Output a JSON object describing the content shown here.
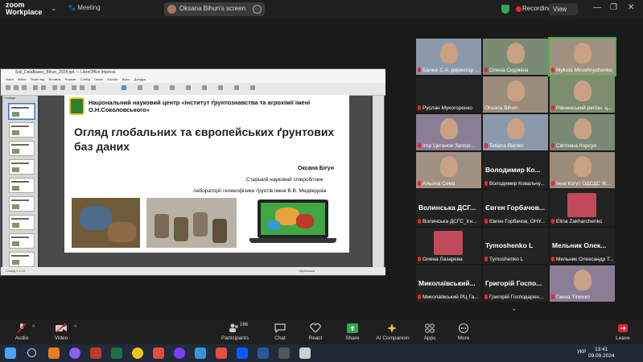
{
  "app": {
    "logo_line1": "zoom",
    "logo_line2": "Workplace",
    "meeting_label": "Meeting"
  },
  "share": {
    "label": "Oksana Bihun's screen"
  },
  "status": {
    "recording": "Recording",
    "view": "View"
  },
  "libreoffice": {
    "title": "Soil_DataBases_Bihun_2024.ppt — LibreOffice Impress",
    "menu": [
      "Файл",
      "Зміни",
      "Перегляд",
      "Вставка",
      "Формат",
      "Слайд",
      "Показ",
      "Засоби",
      "Вікно",
      "Довідка"
    ],
    "sidebar_title": "Слайди",
    "status_left": "Слайд 1 з 24",
    "status_mid": "Українська",
    "slide": {
      "institute": "Національний науковий центр «Інститут ґрунтознавства та агрохімії імені О.Н.Соколовського»",
      "title": "Огляд глобальних та європейських ґрунтових баз даних",
      "author": "Оксана Бігун",
      "position": "Старший науковий співробітник",
      "lab": "лабораторії геоекофізики ґрунтів імені В.В. Медведєва"
    }
  },
  "participants_grid": [
    {
      "name": "Балюк С.А. директор ...",
      "muted": true,
      "type": "video"
    },
    {
      "name": "Олена Сидякіна",
      "muted": true,
      "type": "video"
    },
    {
      "name": "Mykola Miroshnychenko",
      "muted": true,
      "type": "video",
      "active": true
    },
    {
      "name": "Руслан Мукогоренко",
      "muted": true,
      "type": "name",
      "big": ""
    },
    {
      "name": "Oksana Bihun",
      "muted": false,
      "type": "video"
    },
    {
      "name": "Рівненський регіон. ц...",
      "muted": true,
      "type": "video"
    },
    {
      "name": "Ігор Циганов Запорі...",
      "muted": true,
      "type": "video"
    },
    {
      "name": "Tetiana Bienko",
      "muted": true,
      "type": "video"
    },
    {
      "name": "Світлана Корсун",
      "muted": true,
      "type": "video"
    },
    {
      "name": "Альона Сема",
      "muted": true,
      "type": "video"
    },
    {
      "name": "Володимир Ковальчу...",
      "muted": true,
      "type": "name",
      "big": "Володимир Ко..."
    },
    {
      "name": "Інна Когут ОДСДС ІК...",
      "muted": true,
      "type": "video"
    },
    {
      "name": "Волинська ДСГС_Ігн...",
      "muted": true,
      "type": "name",
      "big": "Волинська ДСГ..."
    },
    {
      "name": "Євген Горбачов, ОНУ...",
      "muted": true,
      "type": "name",
      "big": "Євген Горбачов..."
    },
    {
      "name": "Elina Zakharchenko",
      "muted": true,
      "type": "avatar"
    },
    {
      "name": "Олена Лазарєва",
      "muted": true,
      "type": "avatar"
    },
    {
      "name": "Tymoshenko L",
      "muted": true,
      "type": "name",
      "big": "Tymoshenko L"
    },
    {
      "name": "Мельник Олександр Т...",
      "muted": true,
      "type": "name",
      "big": "Мельник Олек..."
    },
    {
      "name": "Миколаївський РЦ Га...",
      "muted": true,
      "type": "name",
      "big": "Миколаївський..."
    },
    {
      "name": "Григорій Господарен...",
      "muted": true,
      "type": "name",
      "big": "Григорій Госпо..."
    },
    {
      "name": "Ганна Тіпенко",
      "muted": true,
      "type": "video"
    }
  ],
  "toolbar": {
    "audio": "Audio",
    "video": "Video",
    "participants": "Participants",
    "participants_count": "166",
    "chat": "Chat",
    "react": "React",
    "share": "Share",
    "ai": "AI Companion",
    "apps": "Apps",
    "more": "More",
    "leave": "Leave"
  },
  "taskbar": {
    "lang": "УКР",
    "time": "13:41",
    "date": "09.09.2024"
  },
  "colors": {
    "recording": "#e22233",
    "share_green": "#2fa84f",
    "leave_red": "#e22233"
  }
}
